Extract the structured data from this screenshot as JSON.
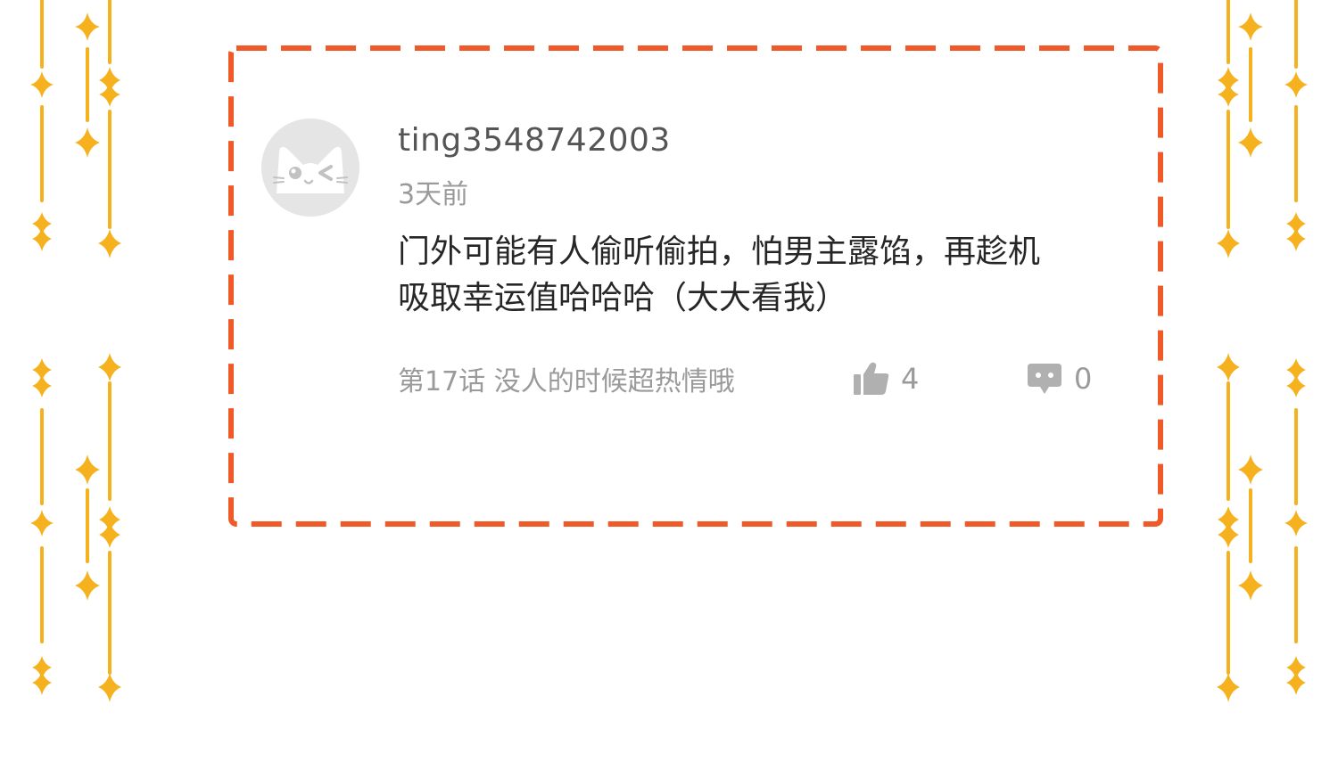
{
  "comment": {
    "username": "ting3548742003",
    "time": "3天前",
    "text_lines": [
      "门外可能有人偷听偷拍，怕男主露馅，再趁机",
      "吸取幸运值哈哈哈（大大看我）"
    ],
    "chapter": "第17话 没人的时候超热情哦",
    "likes": "4",
    "replies": "0",
    "avatar_icon": "cat-face-icon",
    "like_icon": "thumbs-up-icon",
    "reply_icon": "speech-bubble-icon"
  },
  "colors": {
    "border_dash": "#f05a28",
    "sparkle": "#f5b21e",
    "username": "#555555",
    "meta_gray": "#9a9a9a",
    "body_text": "#262626",
    "icon_gray": "#b0b0b0",
    "avatar_bg": "#e5e5e5"
  }
}
